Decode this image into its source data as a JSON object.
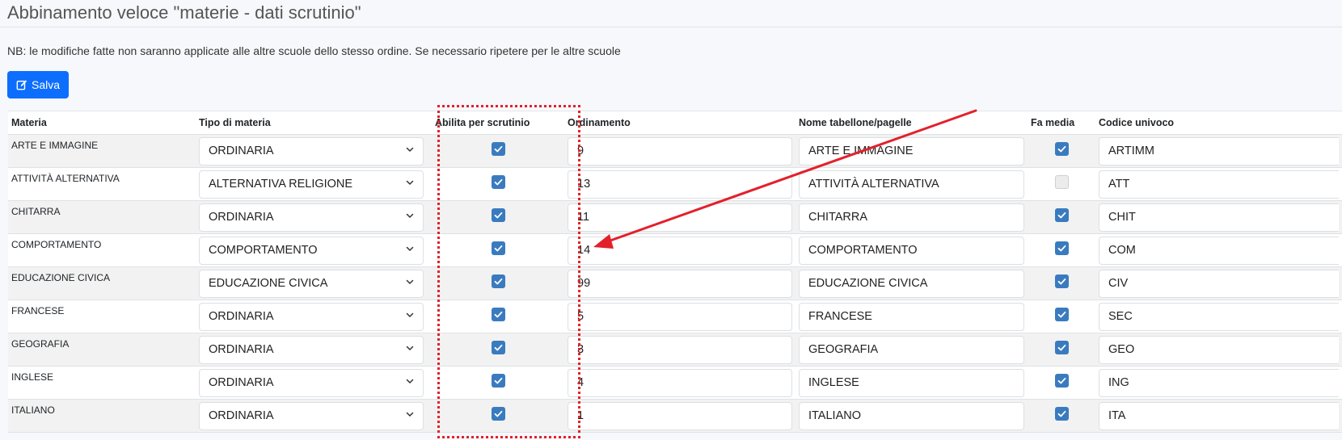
{
  "page": {
    "title": "Abbinamento veloce \"materie - dati scrutinio\"",
    "note": "NB: le modifiche fatte non saranno applicate alle altre scuole dello stesso ordine. Se necessario ripetere per le altre scuole",
    "save_label": "Salva",
    "save_icon": "edit-icon",
    "accent_color": "#0d6efd",
    "annotation_color": "#e2212b"
  },
  "table": {
    "headers": {
      "materia": "Materia",
      "tipo": "Tipo di materia",
      "abilita": "Abilita per scrutinio",
      "ordinamento": "Ordinamento",
      "nome": "Nome tabellone/pagelle",
      "media": "Fa media",
      "codice": "Codice univoco"
    },
    "rows": [
      {
        "materia": "ARTE E IMMAGINE",
        "tipo": "ORDINARIA",
        "abilita": true,
        "ordinamento": "9",
        "nome": "ARTE E IMMAGINE",
        "media": true,
        "codice": "ARTIMM"
      },
      {
        "materia": "ATTIVITÀ ALTERNATIVA",
        "tipo": "ALTERNATIVA RELIGIONE",
        "abilita": true,
        "ordinamento": "13",
        "nome": "ATTIVITÀ ALTERNATIVA",
        "media": false,
        "codice": "ATT"
      },
      {
        "materia": "CHITARRA",
        "tipo": "ORDINARIA",
        "abilita": true,
        "ordinamento": "11",
        "nome": "CHITARRA",
        "media": true,
        "codice": "CHIT"
      },
      {
        "materia": "COMPORTAMENTO",
        "tipo": "COMPORTAMENTO",
        "abilita": true,
        "ordinamento": "14",
        "nome": "COMPORTAMENTO",
        "media": true,
        "codice": "COM"
      },
      {
        "materia": "EDUCAZIONE CIVICA",
        "tipo": "EDUCAZIONE CIVICA",
        "abilita": true,
        "ordinamento": "99",
        "nome": "EDUCAZIONE CIVICA",
        "media": true,
        "codice": "CIV"
      },
      {
        "materia": "FRANCESE",
        "tipo": "ORDINARIA",
        "abilita": true,
        "ordinamento": "5",
        "nome": "FRANCESE",
        "media": true,
        "codice": "SEC"
      },
      {
        "materia": "GEOGRAFIA",
        "tipo": "ORDINARIA",
        "abilita": true,
        "ordinamento": "3",
        "nome": "GEOGRAFIA",
        "media": true,
        "codice": "GEO"
      },
      {
        "materia": "INGLESE",
        "tipo": "ORDINARIA",
        "abilita": true,
        "ordinamento": "4",
        "nome": "INGLESE",
        "media": true,
        "codice": "ING"
      },
      {
        "materia": "ITALIANO",
        "tipo": "ORDINARIA",
        "abilita": true,
        "ordinamento": "1",
        "nome": "ITALIANO",
        "media": true,
        "codice": "ITA"
      }
    ]
  }
}
